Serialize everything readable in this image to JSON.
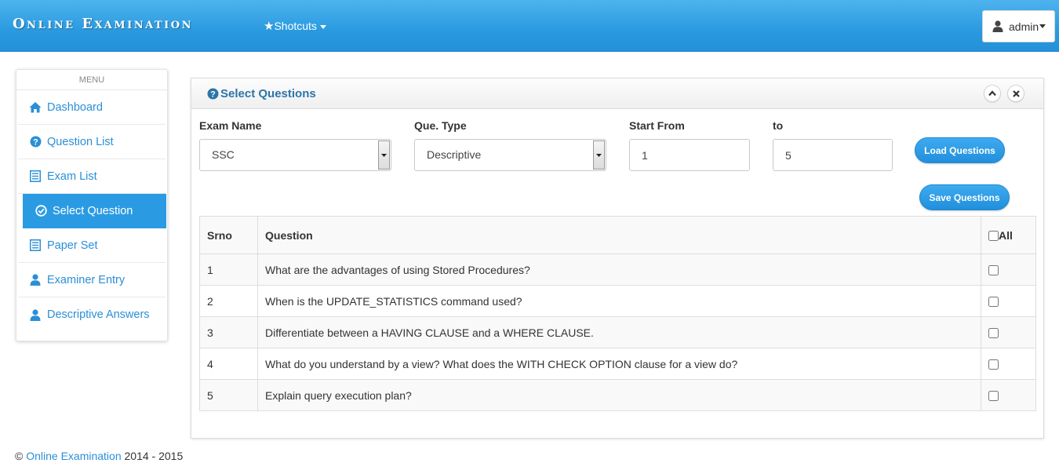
{
  "navbar": {
    "brand": "Online Examination",
    "shortcuts_label": "Shotcuts",
    "user_label": "admin"
  },
  "sidebar": {
    "menu_title": "MENU",
    "items": [
      {
        "label": "Dashboard",
        "icon": "home-icon"
      },
      {
        "label": "Question List",
        "icon": "question-circle-icon"
      },
      {
        "label": "Exam List",
        "icon": "list-icon"
      },
      {
        "label": "Select Question",
        "icon": "check-circle-icon",
        "active": true
      },
      {
        "label": "Paper Set",
        "icon": "list-icon"
      },
      {
        "label": "Examiner Entry",
        "icon": "user-icon"
      },
      {
        "label": "Descriptive Answers",
        "icon": "user-icon"
      }
    ]
  },
  "panel": {
    "title": "Select Questions",
    "form": {
      "exam_name_label": "Exam Name",
      "exam_name_value": "SSC",
      "que_type_label": "Que. Type",
      "que_type_value": "Descriptive",
      "start_from_label": "Start From",
      "start_from_value": "1",
      "to_label": "to",
      "to_value": "5",
      "load_button": "Load Questions",
      "save_button": "Save Questions"
    },
    "table": {
      "headers": {
        "srno": "Srno",
        "question": "Question",
        "all": "All"
      },
      "rows": [
        {
          "srno": "1",
          "question": "What are the advantages of using Stored Procedures?"
        },
        {
          "srno": "2",
          "question": "When is the UPDATE_STATISTICS command used?"
        },
        {
          "srno": "3",
          "question": "Differentiate between a HAVING CLAUSE and a WHERE CLAUSE."
        },
        {
          "srno": "4",
          "question": "What do you understand by a view? What does the WITH CHECK OPTION clause for a view do?"
        },
        {
          "srno": "5",
          "question": "Explain query execution plan?"
        }
      ]
    }
  },
  "footer": {
    "copyright": "©",
    "link_text": "Online Examination",
    "years": "2014 - 2015"
  },
  "colors": {
    "navbar": "#2a9ae0",
    "accent": "#2a8fd6",
    "active_item": "#2a9be3",
    "panel_title": "#2d74a8"
  }
}
